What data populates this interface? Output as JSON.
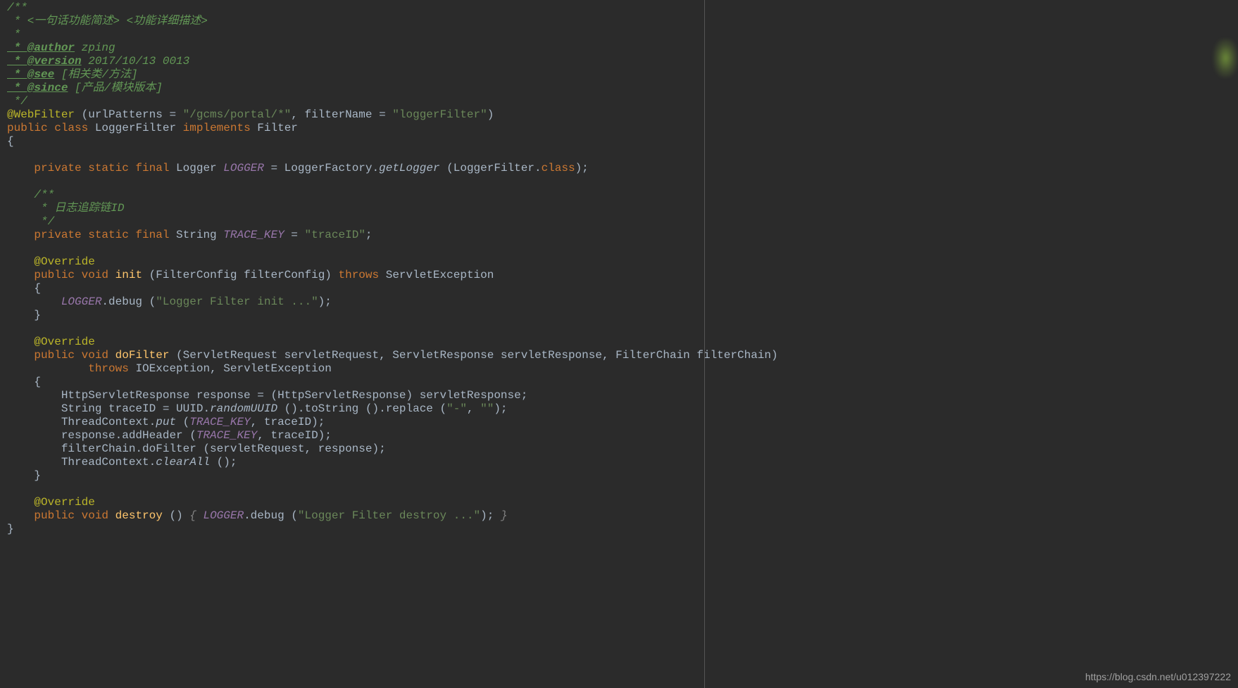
{
  "watermark": "https://blog.csdn.net/u012397222",
  "code": {
    "doc_open": "/**",
    "doc_l1": " * <一句话功能简述> <功能详细描述>",
    "doc_l2": " *",
    "doc_author_tag": " * @author",
    "doc_author_val": " zping",
    "doc_version_tag": " * @version",
    "doc_version_val": " 2017/10/13 0013",
    "doc_see_tag": " * @see",
    "doc_see_val": " [相关类/方法]",
    "doc_since_tag": " * @since",
    "doc_since_val": " [产品/模块版本]",
    "doc_close": " */",
    "ann_webfilter": "@WebFilter",
    "wf_params_1": " (urlPatterns = ",
    "wf_url": "\"/gcms/portal/*\"",
    "wf_params_2": ", filterName = ",
    "wf_name": "\"loggerFilter\"",
    "wf_params_3": ")",
    "kw_public": "public ",
    "kw_class": "class ",
    "cls_name": "LoggerFilter ",
    "kw_implements": "implements ",
    "iface": "Filter",
    "brace_o": "{",
    "brace_c": "}",
    "logger_decl_1": "private static final ",
    "logger_type": "Logger ",
    "logger_field": "LOGGER",
    "logger_decl_2": " = LoggerFactory.",
    "getlogger": "getLogger",
    "logger_decl_3": " (LoggerFilter.",
    "kw_class2": "class",
    "logger_decl_4": ");",
    "doc2_open": "/**",
    "doc2_l1": " * 日志追踪链ID",
    "doc2_close": " */",
    "tk_decl_1": "private static final ",
    "tk_type": "String ",
    "tk_field": "TRACE_KEY",
    "tk_decl_2": " = ",
    "tk_val": "\"traceID\"",
    "tk_decl_3": ";",
    "override": "@Override",
    "kw_void": "void ",
    "kw_throws": "throws ",
    "m_init": "init",
    "init_params": " (FilterConfig filterConfig) ",
    "init_throws": "ServletException",
    "init_body1": ".debug (",
    "init_str": "\"Logger Filter init ...\"",
    "init_body2": ");",
    "m_dofilter": "doFilter",
    "df_params": " (ServletRequest servletRequest, ServletResponse servletResponse, FilterChain filterChain)",
    "df_throws_kw": "throws ",
    "df_throws": "IOException, ServletException",
    "df_l1a": "HttpServletResponse response = (HttpServletResponse) servletResponse;",
    "df_l2a": "String traceID = UUID.",
    "df_l2b": "randomUUID",
    "df_l2c": " ().toString ().replace (",
    "df_l2d": "\"-\"",
    "df_l2e": ", ",
    "df_l2f": "\"\"",
    "df_l2g": ");",
    "df_l3a": "ThreadContext.",
    "df_l3b": "put",
    "df_l3c": " (",
    "df_l3d": ", traceID);",
    "df_l4a": "response.addHeader (",
    "df_l4b": ", traceID);",
    "df_l5a": "filterChain.doFilter (servletRequest, response);",
    "df_l6a": "ThreadContext.",
    "df_l6b": "clearAll",
    "df_l6c": " ();",
    "m_destroy": "destroy",
    "destroy_params": " () ",
    "destroy_brace_o": "{ ",
    "destroy_body1": ".debug (",
    "destroy_str": "\"Logger Filter destroy ...\"",
    "destroy_body2": "); ",
    "destroy_brace_c": "}"
  }
}
